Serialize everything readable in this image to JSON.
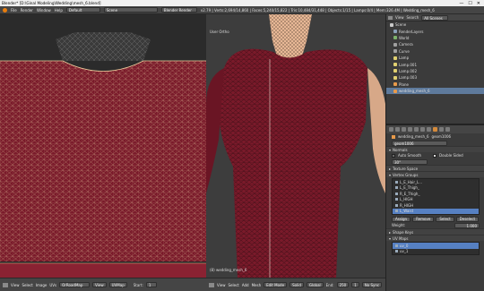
{
  "window": {
    "title": "Blender* [D:\\Ginal Modeling\\Wedding\\mesh_6.blend]",
    "controls": [
      "—",
      "☐",
      "✕"
    ]
  },
  "infobar": {
    "menu": [
      "File",
      "Render",
      "Window",
      "Help"
    ],
    "layout": "Default",
    "scene": "Scene",
    "engine": "Blender Render",
    "stats": "v2.79 | Verts:2,694/14,860 | Faces:5,240/15,822 | Tris:10,484/31,448 | Objects:1/15 | Lamps:0/4 | Mem:326.4M | Wedding_mesh_6"
  },
  "uv_editor": {
    "header_items": [
      "View",
      "Select",
      "Image",
      "UVs"
    ],
    "image_name": "OrRoadMap",
    "extra": [
      "View",
      "UVMap"
    ]
  },
  "viewport": {
    "label": "User Ortho",
    "object_label": "(8) wedding_mesh_6",
    "header_items": [
      "View",
      "Select",
      "Add",
      "Mesh"
    ],
    "mode": "Edit Mode",
    "pivot": "Global",
    "shading": "Solid"
  },
  "timeline": {
    "items": [
      "View",
      "Marker",
      "Frame",
      "Playback"
    ],
    "start_label": "Start:",
    "start": "1",
    "end_label": "End:",
    "end": "250",
    "current": "1",
    "sync": "No Sync"
  },
  "outliner": {
    "header": [
      "View",
      "Search",
      "All Scenes"
    ],
    "rows": [
      {
        "name": "Scene",
        "icon_color": "#c9c9c9",
        "indent": 0
      },
      {
        "name": "RenderLayers",
        "icon_color": "#8aa0b8",
        "indent": 1
      },
      {
        "name": "World",
        "icon_color": "#7db26b",
        "indent": 1
      },
      {
        "name": "Camera",
        "icon_color": "#a0a0a0",
        "indent": 1
      },
      {
        "name": "Curve",
        "icon_color": "#a0a0a0",
        "indent": 1
      },
      {
        "name": "Lamp",
        "icon_color": "#e0d070",
        "indent": 1
      },
      {
        "name": "Lamp.001",
        "icon_color": "#e0d070",
        "indent": 1
      },
      {
        "name": "Lamp.002",
        "icon_color": "#e0d070",
        "indent": 1
      },
      {
        "name": "Lamp.003",
        "icon_color": "#e0d070",
        "indent": 1
      },
      {
        "name": "Plane",
        "icon_color": "#e89a4a",
        "indent": 1
      },
      {
        "name": "wedding_mesh_6",
        "icon_color": "#e89a4a",
        "indent": 1,
        "selected": true
      }
    ]
  },
  "properties": {
    "object_name": "wedding_mesh_6",
    "mesh_name": "geom1006",
    "data_name": "geom1006",
    "sections": {
      "normals": "Normals",
      "auto_smooth": "Auto Smooth",
      "double_sided": "Double Sided",
      "angle": "30°",
      "texture_space": "Texture Space",
      "vertex_groups": "Vertex Groups",
      "shape_keys": "Shape Keys",
      "uv_maps": "UV Maps"
    },
    "vertex_groups": [
      {
        "name": "L_E_Hair_L...",
        "selected": false
      },
      {
        "name": "L_E_Thigh_",
        "selected": false
      },
      {
        "name": "R_E_Thigh_",
        "selected": false
      },
      {
        "name": "L_HIGH",
        "selected": false
      },
      {
        "name": "R_HIGH",
        "selected": false
      },
      {
        "name": "L_Waist",
        "selected": true
      }
    ],
    "vg_buttons": [
      "Assign",
      "Remove",
      "Select",
      "Deselect"
    ],
    "weight_label": "Weight:",
    "weight_value": "1.000",
    "uv_maps": [
      {
        "name": "uv_0",
        "selected": true
      },
      {
        "name": "uv_1",
        "selected": false
      }
    ]
  },
  "colors": {
    "mesh_red": "#7a1a2a",
    "wire": "#f0c8a0",
    "selected_row": "#5680c2",
    "accent_orange": "#d48a3b"
  }
}
